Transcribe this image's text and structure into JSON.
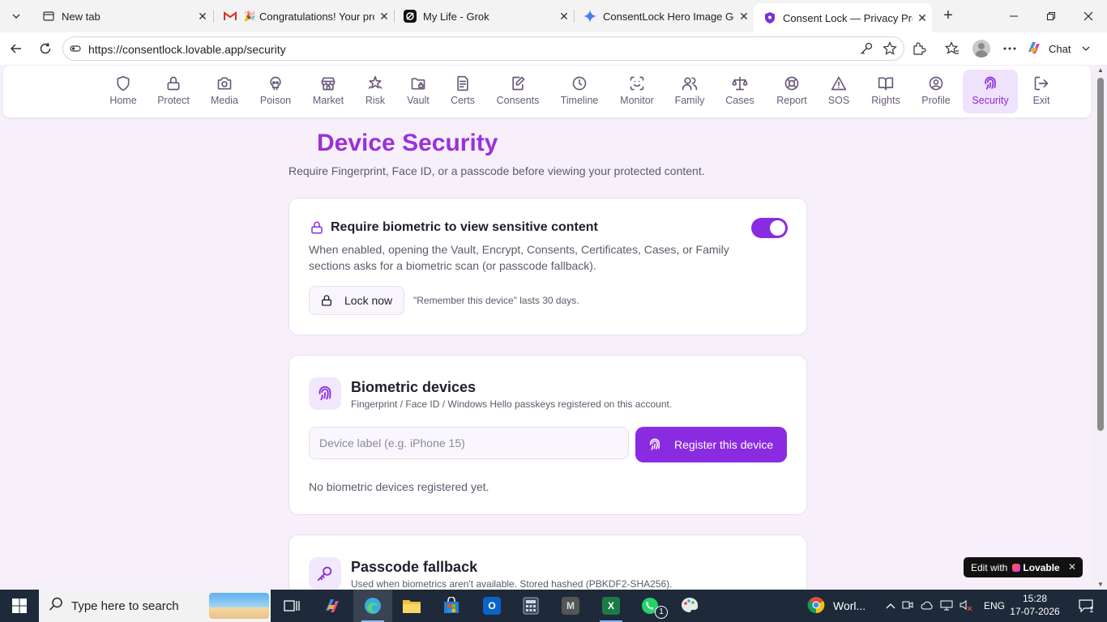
{
  "browser": {
    "tabs": [
      {
        "title": "New tab",
        "icon": "new-tab-icon"
      },
      {
        "title": "Congratulations! Your proje",
        "icon": "gmail-icon"
      },
      {
        "title": "My Life - Grok",
        "icon": "grok-icon"
      },
      {
        "title": "ConsentLock Hero Image Gene",
        "icon": "gemini-icon"
      },
      {
        "title": "Consent Lock — Privacy Protec",
        "icon": "consentlock-icon"
      }
    ],
    "url": "https://consentlock.lovable.app/security",
    "chat_label": "Chat"
  },
  "app_nav": [
    {
      "label": "Home",
      "icon": "shield-icon"
    },
    {
      "label": "Protect",
      "icon": "lock-icon"
    },
    {
      "label": "Media",
      "icon": "camera-icon"
    },
    {
      "label": "Poison",
      "icon": "skull-icon"
    },
    {
      "label": "Market",
      "icon": "store-icon"
    },
    {
      "label": "Risk",
      "icon": "bug-icon"
    },
    {
      "label": "Vault",
      "icon": "folder-lock-icon"
    },
    {
      "label": "Certs",
      "icon": "document-icon"
    },
    {
      "label": "Consents",
      "icon": "file-signature-icon"
    },
    {
      "label": "Timeline",
      "icon": "clock-icon"
    },
    {
      "label": "Monitor",
      "icon": "scan-face-icon"
    },
    {
      "label": "Family",
      "icon": "users-icon"
    },
    {
      "label": "Cases",
      "icon": "scale-icon"
    },
    {
      "label": "Report",
      "icon": "lifebuoy-icon"
    },
    {
      "label": "SOS",
      "icon": "alert-triangle-icon"
    },
    {
      "label": "Rights",
      "icon": "book-open-icon"
    },
    {
      "label": "Profile",
      "icon": "user-circle-icon"
    },
    {
      "label": "Security",
      "icon": "fingerprint-icon"
    },
    {
      "label": "Exit",
      "icon": "log-out-icon"
    }
  ],
  "active_nav": "Security",
  "page": {
    "title": "Device Security",
    "subtitle": "Require Fingerprint, Face ID, or a passcode before viewing your protected content."
  },
  "biometric_card": {
    "title": "Require biometric to view sensitive content",
    "description": "When enabled, opening the Vault, Encrypt, Consents, Certificates, Cases, or Family sections asks for a biometric scan (or passcode fallback).",
    "toggle_on": true,
    "lock_now_label": "Lock now",
    "remember_note": "\"Remember this device\" lasts 30 days."
  },
  "devices_card": {
    "title": "Biometric devices",
    "subtitle": "Fingerprint / Face ID / Windows Hello passkeys registered on this account.",
    "input_placeholder": "Device label (e.g. iPhone 15)",
    "register_label": "Register this device",
    "empty_message": "No biometric devices registered yet."
  },
  "passcode_card": {
    "title": "Passcode fallback",
    "subtitle": "Used when biometrics aren't available. Stored hashed (PBKDF2-SHA256)."
  },
  "lovable_badge": {
    "prefix": "Edit with",
    "brand": "Lovable"
  },
  "taskbar": {
    "search_placeholder": "Type here to search",
    "weather_text": "Worl...",
    "language": "ENG",
    "time": "15:28",
    "date": "17-07-2026",
    "notification_count": "1",
    "whatsapp_badge": "1"
  },
  "colors": {
    "accent": "#8a2be2",
    "title": "#9b30d9",
    "page_bg": "#f7f0fb"
  }
}
